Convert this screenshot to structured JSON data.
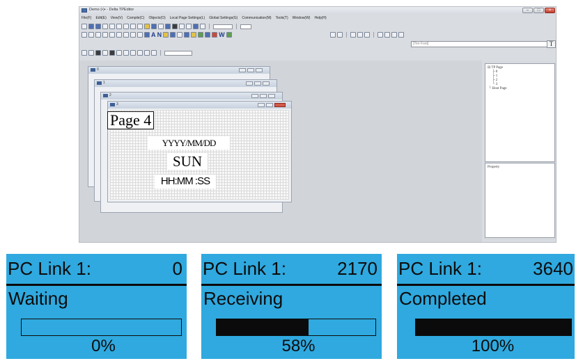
{
  "app": {
    "title": "Demo (•)• - Delta TPEditor",
    "menu": [
      "File(F)",
      "Edit(E)",
      "View(V)",
      "Compile(C)",
      "Objects(O)",
      "Local Page Settings(L)",
      "Global Settings(G)",
      "Communication(M)",
      "Tools(T)",
      "Window(W)",
      "Help(H)"
    ],
    "toolbar_text": {
      "text_tool": "A N",
      "wav_tool": "W",
      "font_button": "T"
    },
    "font_placeholder": "[Tim Font]"
  },
  "pages": {
    "child_windows": [
      "0",
      "1",
      "2",
      "3"
    ],
    "page_label": "Page 4",
    "date_label": "YYYY/MM/DD",
    "day_label": "SUN",
    "time_label": "HH:MM :SS"
  },
  "tree": {
    "root": "TP Page",
    "items": [
      "0",
      "1",
      "2",
      "3"
    ],
    "boot": "Boot Page"
  },
  "properties": {
    "tab": "Property"
  },
  "lcd_panels": [
    {
      "title": "PC Link 1:",
      "count": "0",
      "status": "Waiting",
      "progress": 0,
      "percent": "0%"
    },
    {
      "title": "PC Link 1:",
      "count": "2170",
      "status": "Receiving",
      "progress": 58,
      "percent": "58%"
    },
    {
      "title": "PC Link 1:",
      "count": "3640",
      "status": "Completed",
      "progress": 100,
      "percent": "100%"
    }
  ],
  "colors": {
    "lcd_background": "#2fa9df",
    "lcd_ink": "#0b0b0b",
    "close_button": "#c43b2a"
  }
}
